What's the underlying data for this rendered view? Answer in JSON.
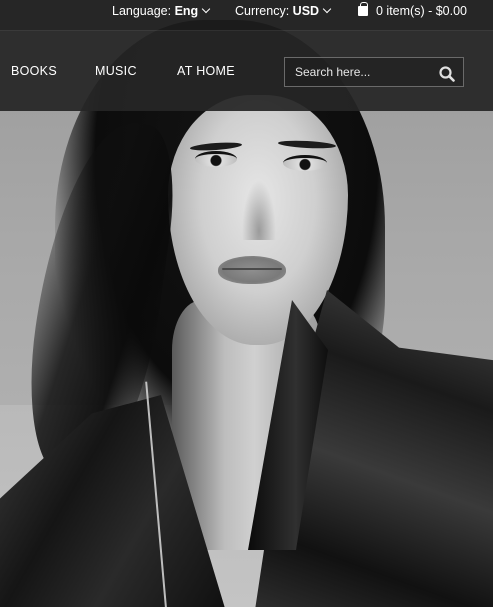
{
  "topbar": {
    "language_label": "Language:",
    "language_value": "Eng",
    "currency_label": "Currency:",
    "currency_value": "USD",
    "cart_summary": "0 item(s) - $0.00"
  },
  "nav": {
    "items": [
      {
        "label": "BOOKS"
      },
      {
        "label": "MUSIC"
      },
      {
        "label": "AT HOME"
      }
    ]
  },
  "search": {
    "placeholder": "Search here...",
    "value": ""
  },
  "icons": {
    "cart": "shopping-bag-icon",
    "search": "search-icon",
    "dropdown": "chevron-down-icon"
  },
  "colors": {
    "topbar_bg": "#1c1c1c",
    "navbar_bg": "#262626",
    "text": "#ffffff"
  }
}
